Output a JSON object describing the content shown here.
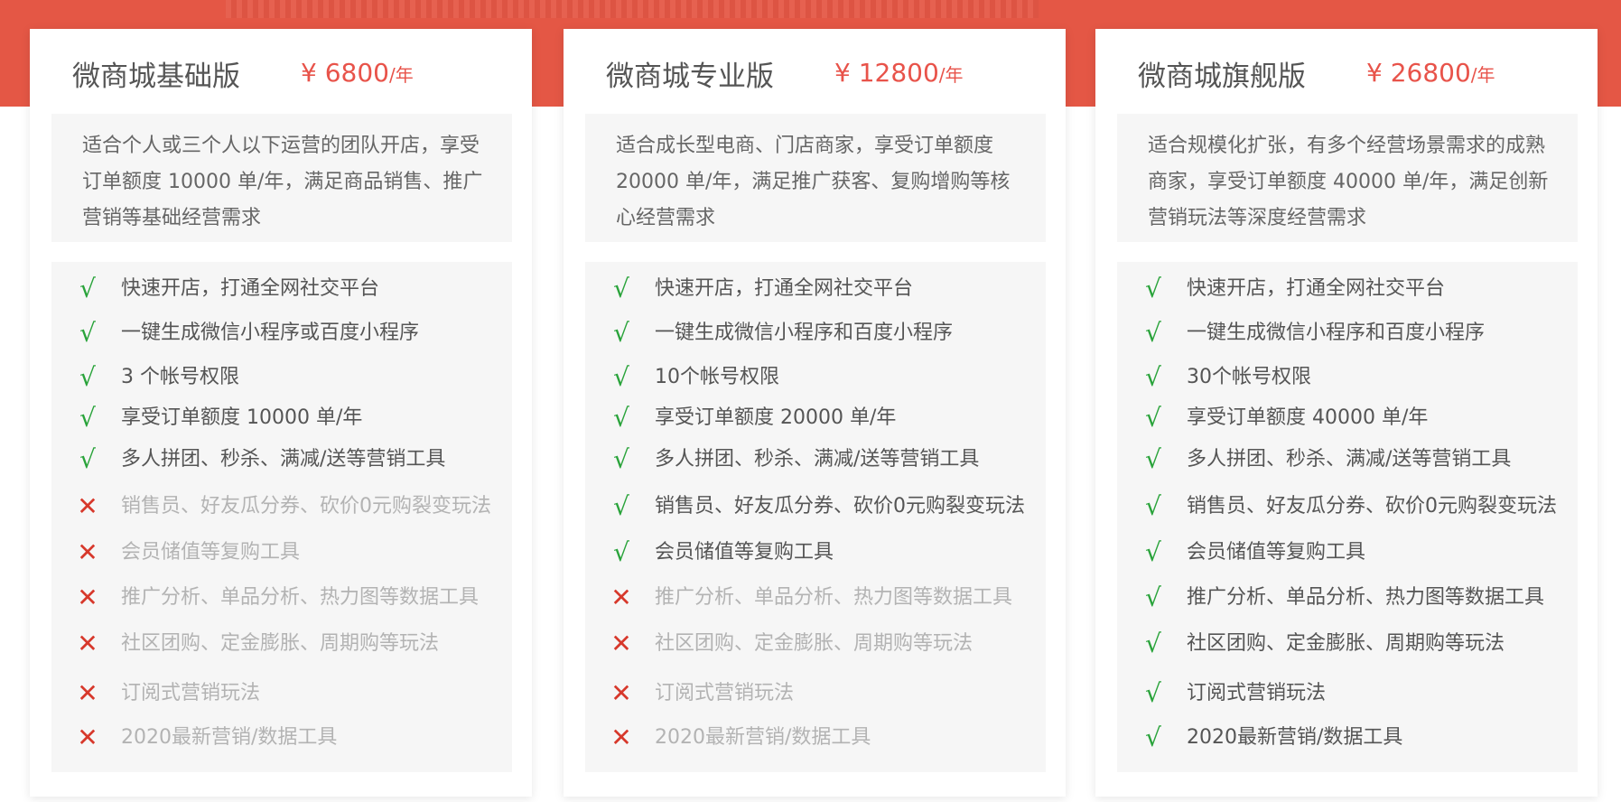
{
  "plans": [
    {
      "name": "微商城基础版",
      "price": "¥ 6800",
      "unit": "/年",
      "description": "适合个人或三个人以下运营的团队开店，享受订单额度 10000 单/年，满足商品销售、推广营销等基础经营需求",
      "features": [
        {
          "label": "快速开店，打通全网社交平台",
          "included": true
        },
        {
          "label": "一键生成微信小程序或百度小程序",
          "included": true
        },
        {
          "label": "3 个帐号权限",
          "included": true
        },
        {
          "label": "享受订单额度 10000 单/年",
          "included": true
        },
        {
          "label": "多人拼团、秒杀、满减/送等营销工具",
          "included": true
        },
        {
          "label": "销售员、好友瓜分券、砍价0元购裂变玩法",
          "included": false
        },
        {
          "label": "会员储值等复购工具",
          "included": false
        },
        {
          "label": "推广分析、单品分析、热力图等数据工具",
          "included": false
        },
        {
          "label": "社区团购、定金膨胀、周期购等玩法",
          "included": false
        },
        {
          "label": "订阅式营销玩法",
          "included": false
        },
        {
          "label": "2020最新营销/数据工具",
          "included": false
        }
      ]
    },
    {
      "name": "微商城专业版",
      "price": "¥ 12800",
      "unit": "/年",
      "description": "适合成长型电商、门店商家，享受订单额度 20000 单/年，满足推广获客、复购增购等核心经营需求",
      "features": [
        {
          "label": "快速开店，打通全网社交平台",
          "included": true
        },
        {
          "label": "一键生成微信小程序和百度小程序",
          "included": true
        },
        {
          "label": "10个帐号权限",
          "included": true
        },
        {
          "label": "享受订单额度 20000 单/年",
          "included": true
        },
        {
          "label": "多人拼团、秒杀、满减/送等营销工具",
          "included": true
        },
        {
          "label": "销售员、好友瓜分券、砍价0元购裂变玩法",
          "included": true
        },
        {
          "label": "会员储值等复购工具",
          "included": true
        },
        {
          "label": "推广分析、单品分析、热力图等数据工具",
          "included": false
        },
        {
          "label": "社区团购、定金膨胀、周期购等玩法",
          "included": false
        },
        {
          "label": "订阅式营销玩法",
          "included": false
        },
        {
          "label": "2020最新营销/数据工具",
          "included": false
        }
      ]
    },
    {
      "name": "微商城旗舰版",
      "price": "¥ 26800",
      "unit": "/年",
      "description": "适合规模化扩张，有多个经营场景需求的成熟商家，享受订单额度 40000 单/年，满足创新营销玩法等深度经营需求",
      "features": [
        {
          "label": "快速开店，打通全网社交平台",
          "included": true
        },
        {
          "label": "一键生成微信小程序和百度小程序",
          "included": true
        },
        {
          "label": "30个帐号权限",
          "included": true
        },
        {
          "label": "享受订单额度 40000 单/年",
          "included": true
        },
        {
          "label": "多人拼团、秒杀、满减/送等营销工具",
          "included": true
        },
        {
          "label": "销售员、好友瓜分券、砍价0元购裂变玩法",
          "included": true
        },
        {
          "label": "会员储值等复购工具",
          "included": true
        },
        {
          "label": "推广分析、单品分析、热力图等数据工具",
          "included": true
        },
        {
          "label": "社区团购、定金膨胀、周期购等玩法",
          "included": true
        },
        {
          "label": "订阅式营销玩法",
          "included": true
        },
        {
          "label": "2020最新营销/数据工具",
          "included": true
        }
      ]
    }
  ],
  "icons": {
    "included": "check-icon",
    "excluded": "cross-icon"
  },
  "colors": {
    "banner": "#e45745",
    "price": "#e8534a",
    "check": "#29a33a",
    "cross": "#d7382b"
  }
}
